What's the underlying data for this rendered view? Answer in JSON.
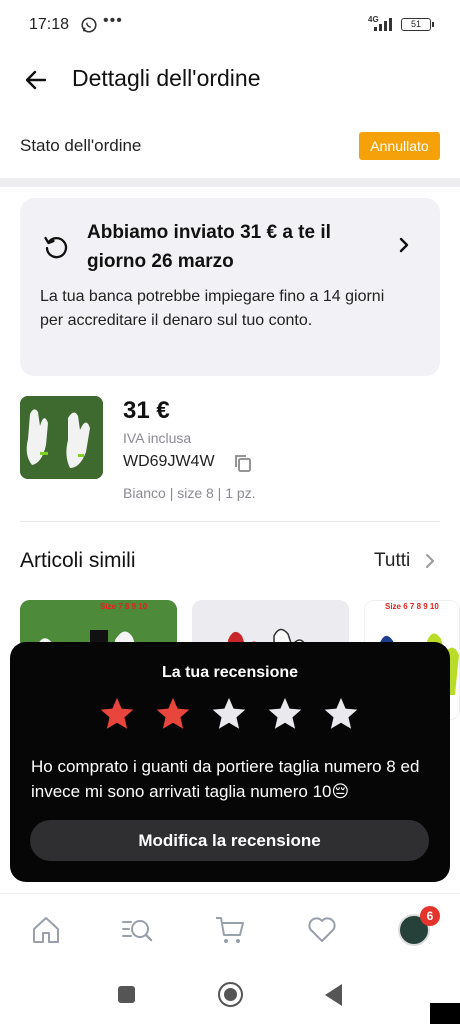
{
  "status_bar": {
    "time": "17:18",
    "network": "4G",
    "battery": "51"
  },
  "header": {
    "title": "Dettagli dell'ordine"
  },
  "order": {
    "state_label": "Stato dell'ordine",
    "status_badge": "Annullato",
    "status_color": "#f5a20a"
  },
  "refund": {
    "title": "Abbiamo inviato 31 € a te il giorno 26 marzo",
    "description": "La tua banca potrebbe impiegare fino a 14 giorni per accreditare il denaro sul tuo conto."
  },
  "product": {
    "price": "31 €",
    "vat": "IVA inclusa",
    "sku": "WD69JW4W",
    "variant": "Bianco | size 8 | 1 pz."
  },
  "similar": {
    "title": "Articoli simili",
    "all_label": "Tutti",
    "items": [
      {
        "overlay_text": "Size 7 8 9 10"
      },
      {
        "overlay_text": ""
      },
      {
        "overlay_text": "Size 6 7 8 9 10"
      }
    ]
  },
  "review": {
    "title": "La tua recensione",
    "rating": 2,
    "max_rating": 5,
    "star_color_active": "#e8453c",
    "star_color_inactive": "#e9e9ee",
    "text": "Ho comprato i guanti da portiere taglia numero 8 ed invece mi sono arrivati taglia numero 10😔",
    "edit_button": "Modifica la recensione"
  },
  "bottom_nav": {
    "items": [
      "home-icon",
      "search-icon",
      "cart-icon",
      "heart-icon",
      "profile-avatar"
    ],
    "badge": "6",
    "badge_color": "#e5342d"
  }
}
